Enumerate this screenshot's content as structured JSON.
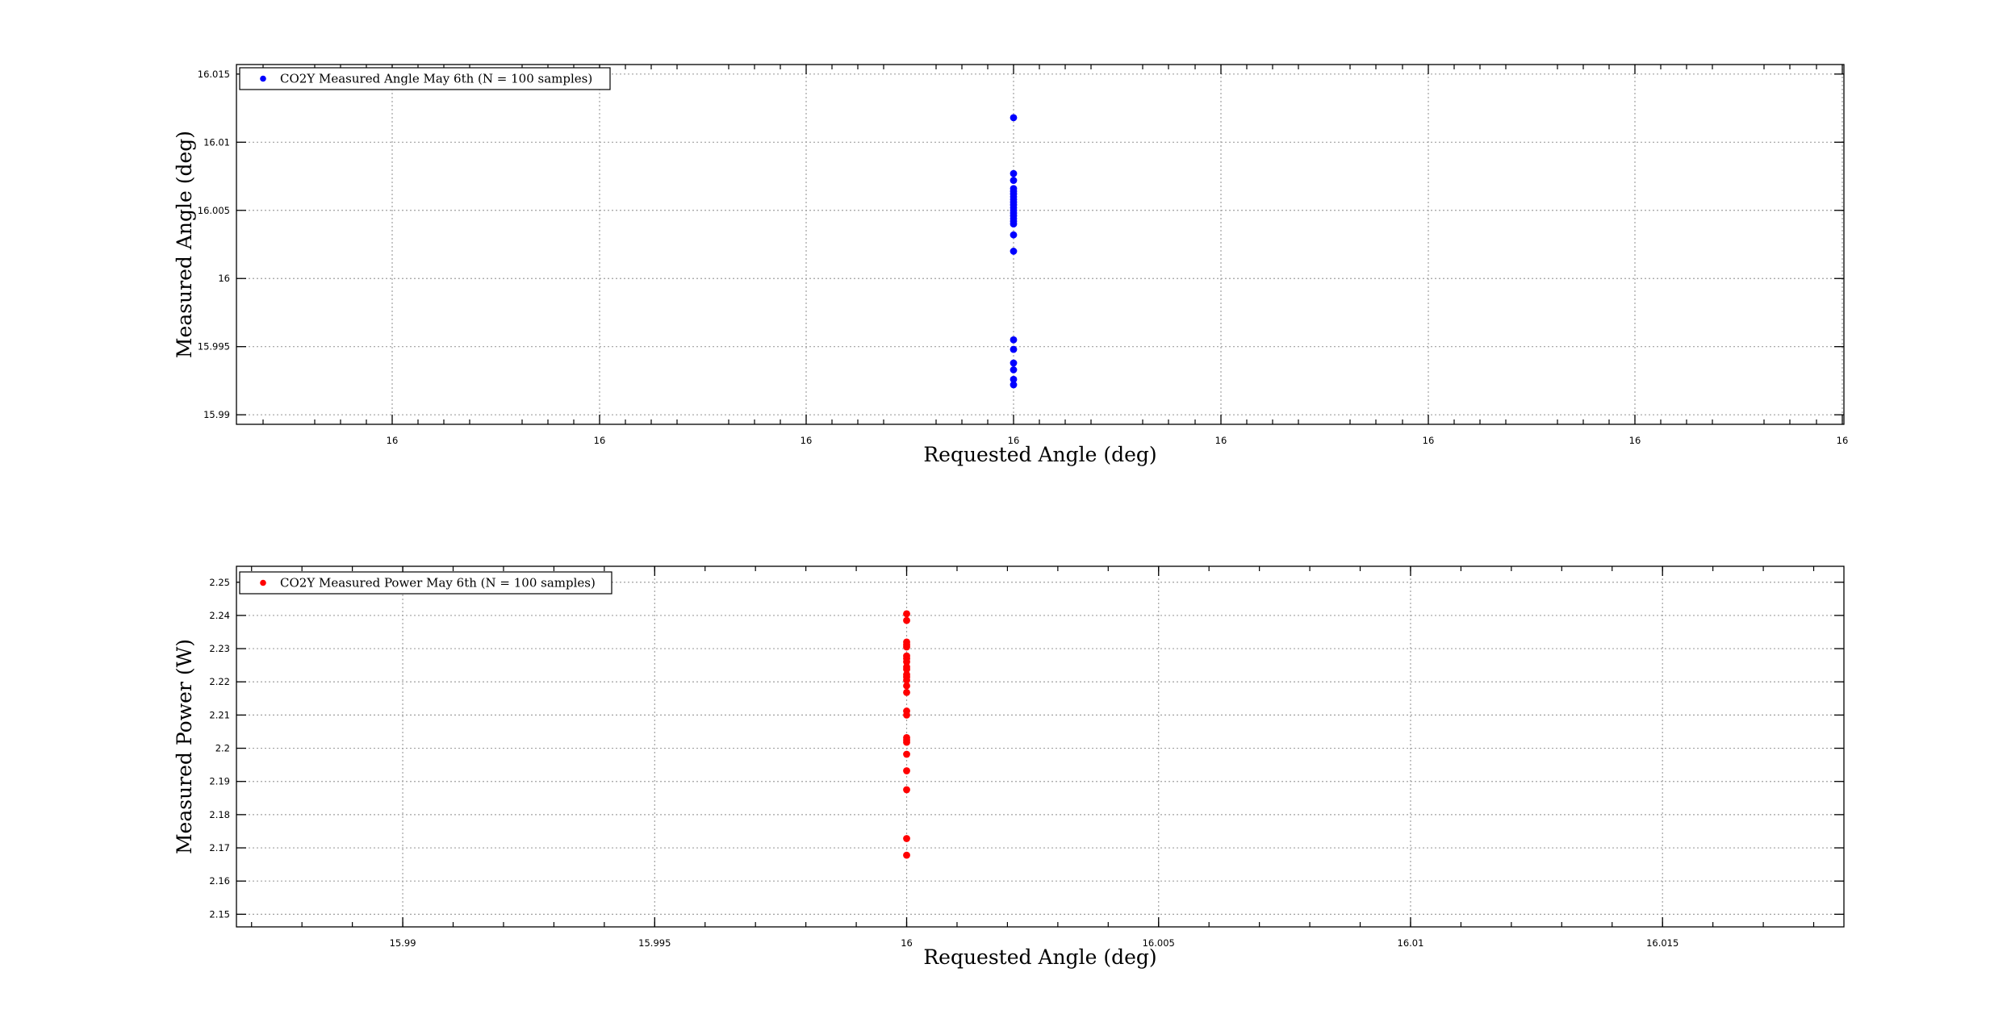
{
  "colors": {
    "series1": "#0000ff",
    "series2": "#ff0000",
    "grid": "#a0a0a0",
    "axes": "#000000"
  },
  "chart_data": [
    {
      "type": "scatter",
      "title": "",
      "xlabel": "Requested Angle (deg)",
      "ylabel": "Measured Angle (deg)",
      "xlim": [
        15.98,
        15.98
      ],
      "ylim": [
        15.9893,
        16.0157
      ],
      "x_tick_labels": [
        "16",
        "16",
        "16",
        "16",
        "16",
        "16",
        "16",
        "16"
      ],
      "y_ticks": [
        15.99,
        15.995,
        16.0,
        16.005,
        16.01,
        16.015
      ],
      "y_tick_labels": [
        "15.99",
        "15.995",
        "16",
        "16.005",
        "16.01",
        "16.015"
      ],
      "grid": true,
      "legend_position": "top-left",
      "series": [
        {
          "name": "CO2Y Measured Angle May 6th (N = 100 samples)",
          "color": "#0000ff",
          "x": 16,
          "values": [
            16.0118,
            16.0077,
            16.0072,
            16.0066,
            16.0064,
            16.0062,
            16.006,
            16.0058,
            16.0056,
            16.0054,
            16.0052,
            16.005,
            16.0048,
            16.0046,
            16.0044,
            16.0042,
            16.004,
            16.0032,
            16.002,
            15.9955,
            15.9948,
            15.9938,
            15.9933,
            15.9926,
            15.9922
          ]
        }
      ]
    },
    {
      "type": "scatter",
      "title": "",
      "xlabel": "Requested Angle (deg)",
      "ylabel": "Measured Power (W)",
      "xlim": [
        15.9867,
        16.0186
      ],
      "ylim": [
        2.1462,
        2.2548
      ],
      "x_ticks": [
        15.99,
        15.995,
        16.0,
        16.005,
        16.01,
        16.015
      ],
      "x_tick_labels": [
        "15.99",
        "15.995",
        "16",
        "16.005",
        "16.01",
        "16.015"
      ],
      "y_ticks": [
        2.15,
        2.16,
        2.17,
        2.18,
        2.19,
        2.2,
        2.21,
        2.22,
        2.23,
        2.24,
        2.25
      ],
      "y_tick_labels": [
        "2.15",
        "2.16",
        "2.17",
        "2.18",
        "2.19",
        "2.2",
        "2.21",
        "2.22",
        "2.23",
        "2.24",
        "2.25"
      ],
      "grid": true,
      "legend_position": "top-left",
      "series": [
        {
          "name": "CO2Y Measured Power May 6th (N = 100 samples)",
          "color": "#ff0000",
          "x": 16,
          "values": [
            2.2405,
            2.2385,
            2.232,
            2.2312,
            2.2305,
            2.2278,
            2.227,
            2.226,
            2.2245,
            2.2238,
            2.2222,
            2.2215,
            2.2205,
            2.2188,
            2.2168,
            2.2112,
            2.21,
            2.2032,
            2.2025,
            2.2018,
            2.1982,
            2.1932,
            2.1875,
            2.1728,
            2.1678
          ]
        }
      ]
    }
  ]
}
